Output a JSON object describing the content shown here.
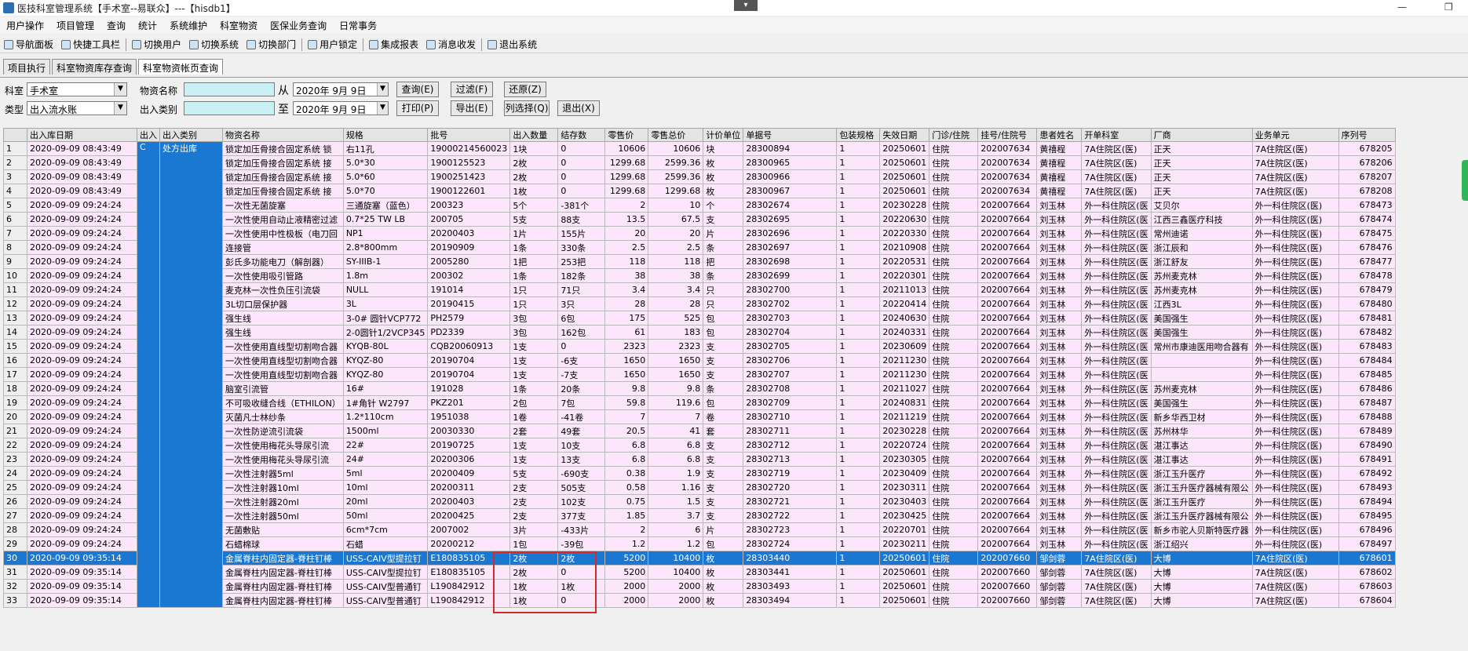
{
  "window": {
    "title": "医技科室管理系统【手术室--易联众】---【hisdb1】",
    "collapse_icon": "chevron-down-icon",
    "min_glyph": "—",
    "restore_glyph": "❐"
  },
  "menu": [
    "用户操作",
    "项目管理",
    "查询",
    "统计",
    "系统维护",
    "科室物资",
    "医保业务查询",
    "日常事务"
  ],
  "toolbar": {
    "items": [
      "导航面板",
      "快捷工具栏",
      "切换用户",
      "切换系统",
      "切换部门",
      "用户锁定",
      "集成报表",
      "消息收发",
      "退出系统"
    ]
  },
  "tabs": [
    "项目执行",
    "科室物资库存查询",
    "科室物资帐页查询"
  ],
  "active_tab": 2,
  "filters": {
    "dept_label": "科室",
    "dept_value": "手术室",
    "type_label": "类型",
    "type_value": "出入流水账",
    "item_name_label": "物资名称",
    "io_type_label": "出入类别",
    "from_label": "从",
    "to_label": "至",
    "date_from": "2020年 9月 9日",
    "date_to": "2020年 9月 9日",
    "buttons": {
      "query": "查询(E)",
      "filter": "过滤(F)",
      "restore": "还原(Z)",
      "print": "打印(P)",
      "export": "导出(E)",
      "columns": "列选择(Q)",
      "exit": "退出(X)"
    }
  },
  "grid": {
    "columns": [
      "",
      "出入库日期",
      "出入",
      "出入类别",
      "物资名称",
      "规格",
      "批号",
      "出入数量",
      "结存数",
      "零售价",
      "零售总价",
      "计价单位",
      "单据号",
      "包装规格",
      "失效日期",
      "门诊/住院",
      "挂号/住院号",
      "患者姓名",
      "开单科室",
      "厂商",
      "业务单元",
      "序列号"
    ],
    "first_row_flags": {
      "io": "C",
      "io_type": "处方出库"
    },
    "selected_row": 30,
    "rows": [
      [
        "1",
        "2020-09-09 08:43:49",
        "锁定加压骨接合固定系统 锁",
        "右11孔",
        "19000214560023",
        "1块",
        "0",
        "10606",
        "10606",
        "块",
        "28300894",
        "1",
        "20250601",
        "住院",
        "202007634",
        "黄禧程",
        "7A住院区(医)",
        "正天",
        "7A住院区(医)",
        "678205"
      ],
      [
        "2",
        "2020-09-09 08:43:49",
        "锁定加压骨接合固定系统 接",
        "5.0*30",
        "1900125523",
        "2枚",
        "0",
        "1299.68",
        "2599.36",
        "枚",
        "28300965",
        "1",
        "20250601",
        "住院",
        "202007634",
        "黄禧程",
        "7A住院区(医)",
        "正天",
        "7A住院区(医)",
        "678206"
      ],
      [
        "3",
        "2020-09-09 08:43:49",
        "锁定加压骨接合固定系统 接",
        "5.0*60",
        "1900251423",
        "2枚",
        "0",
        "1299.68",
        "2599.36",
        "枚",
        "28300966",
        "1",
        "20250601",
        "住院",
        "202007634",
        "黄禧程",
        "7A住院区(医)",
        "正天",
        "7A住院区(医)",
        "678207"
      ],
      [
        "4",
        "2020-09-09 08:43:49",
        "锁定加压骨接合固定系统 接",
        "5.0*70",
        "1900122601",
        "1枚",
        "0",
        "1299.68",
        "1299.68",
        "枚",
        "28300967",
        "1",
        "20250601",
        "住院",
        "202007634",
        "黄禧程",
        "7A住院区(医)",
        "正天",
        "7A住院区(医)",
        "678208"
      ],
      [
        "5",
        "2020-09-09 09:24:24",
        "一次性无菌旋塞",
        "三通旋塞（蓝色）",
        "200323",
        "5个",
        "-381个",
        "2",
        "10",
        "个",
        "28302674",
        "1",
        "20230228",
        "住院",
        "202007664",
        "刘玉林",
        "外一科住院区(医",
        "艾贝尔",
        "外一科住院区(医)",
        "678473"
      ],
      [
        "6",
        "2020-09-09 09:24:24",
        "一次性使用自动止液精密过滤",
        "0.7*25 TW LB",
        "200705",
        "5支",
        "88支",
        "13.5",
        "67.5",
        "支",
        "28302695",
        "1",
        "20220630",
        "住院",
        "202007664",
        "刘玉林",
        "外一科住院区(医",
        "江西三鑫医疗科技",
        "外一科住院区(医)",
        "678474"
      ],
      [
        "7",
        "2020-09-09 09:24:24",
        "一次性使用中性极板（电刀回",
        "NP1",
        "20200403",
        "1片",
        "155片",
        "20",
        "20",
        "片",
        "28302696",
        "1",
        "20220330",
        "住院",
        "202007664",
        "刘玉林",
        "外一科住院区(医",
        "常州迪诺",
        "外一科住院区(医)",
        "678475"
      ],
      [
        "8",
        "2020-09-09 09:24:24",
        "连接管",
        "2.8*800mm",
        "20190909",
        "1条",
        "330条",
        "2.5",
        "2.5",
        "条",
        "28302697",
        "1",
        "20210908",
        "住院",
        "202007664",
        "刘玉林",
        "外一科住院区(医",
        "浙江辰和",
        "外一科住院区(医)",
        "678476"
      ],
      [
        "9",
        "2020-09-09 09:24:24",
        "彭氏多功能电刀（解剖器）",
        "SY-IIIB-1",
        "2005280",
        "1把",
        "253把",
        "118",
        "118",
        "把",
        "28302698",
        "1",
        "20220531",
        "住院",
        "202007664",
        "刘玉林",
        "外一科住院区(医",
        "浙江舒友",
        "外一科住院区(医)",
        "678477"
      ],
      [
        "10",
        "2020-09-09 09:24:24",
        "一次性使用吸引管路",
        "1.8m",
        "200302",
        "1条",
        "182条",
        "38",
        "38",
        "条",
        "28302699",
        "1",
        "20220301",
        "住院",
        "202007664",
        "刘玉林",
        "外一科住院区(医",
        "苏州麦克林",
        "外一科住院区(医)",
        "678478"
      ],
      [
        "11",
        "2020-09-09 09:24:24",
        "麦克林一次性负压引流袋",
        "NULL",
        "191014",
        "1只",
        "71只",
        "3.4",
        "3.4",
        "只",
        "28302700",
        "1",
        "20211013",
        "住院",
        "202007664",
        "刘玉林",
        "外一科住院区(医",
        "苏州麦克林",
        "外一科住院区(医)",
        "678479"
      ],
      [
        "12",
        "2020-09-09 09:24:24",
        "3L切口层保护器",
        "3L",
        "20190415",
        "1只",
        "3只",
        "28",
        "28",
        "只",
        "28302702",
        "1",
        "20220414",
        "住院",
        "202007664",
        "刘玉林",
        "外一科住院区(医",
        "江西3L",
        "外一科住院区(医)",
        "678480"
      ],
      [
        "13",
        "2020-09-09 09:24:24",
        "强生线",
        "3-0# 圆针VCP772",
        "PH2579",
        "3包",
        "6包",
        "175",
        "525",
        "包",
        "28302703",
        "1",
        "20240630",
        "住院",
        "202007664",
        "刘玉林",
        "外一科住院区(医",
        "美国强生",
        "外一科住院区(医)",
        "678481"
      ],
      [
        "14",
        "2020-09-09 09:24:24",
        "强生线",
        "2-0圆针1/2VCP345",
        "PD2339",
        "3包",
        "162包",
        "61",
        "183",
        "包",
        "28302704",
        "1",
        "20240331",
        "住院",
        "202007664",
        "刘玉林",
        "外一科住院区(医",
        "美国强生",
        "外一科住院区(医)",
        "678482"
      ],
      [
        "15",
        "2020-09-09 09:24:24",
        "一次性使用直线型切割吻合器",
        "KYQB-80L",
        "CQB20060913",
        "1支",
        "0",
        "2323",
        "2323",
        "支",
        "28302705",
        "1",
        "20230609",
        "住院",
        "202007664",
        "刘玉林",
        "外一科住院区(医",
        "常州市康迪医用吻合器有",
        "外一科住院区(医)",
        "678483"
      ],
      [
        "16",
        "2020-09-09 09:24:24",
        "一次性使用直线型切割吻合器",
        "KYQZ-80",
        "20190704",
        "1支",
        "-6支",
        "1650",
        "1650",
        "支",
        "28302706",
        "1",
        "20211230",
        "住院",
        "202007664",
        "刘玉林",
        "外一科住院区(医",
        "",
        "外一科住院区(医)",
        "678484"
      ],
      [
        "17",
        "2020-09-09 09:24:24",
        "一次性使用直线型切割吻合器",
        "KYQZ-80",
        "20190704",
        "1支",
        "-7支",
        "1650",
        "1650",
        "支",
        "28302707",
        "1",
        "20211230",
        "住院",
        "202007664",
        "刘玉林",
        "外一科住院区(医",
        "",
        "外一科住院区(医)",
        "678485"
      ],
      [
        "18",
        "2020-09-09 09:24:24",
        "脑室引流管",
        "16#",
        "191028",
        "1条",
        "20条",
        "9.8",
        "9.8",
        "条",
        "28302708",
        "1",
        "20211027",
        "住院",
        "202007664",
        "刘玉林",
        "外一科住院区(医",
        "苏州麦克林",
        "外一科住院区(医)",
        "678486"
      ],
      [
        "19",
        "2020-09-09 09:24:24",
        "不可吸收缝合线（ETHILON）",
        "1#角针 W2797",
        "PKZ201",
        "2包",
        "7包",
        "59.8",
        "119.6",
        "包",
        "28302709",
        "1",
        "20240831",
        "住院",
        "202007664",
        "刘玉林",
        "外一科住院区(医",
        "美国强生",
        "外一科住院区(医)",
        "678487"
      ],
      [
        "20",
        "2020-09-09 09:24:24",
        "灭菌凡士林纱条",
        "1.2*110cm",
        "1951038",
        "1卷",
        "-41卷",
        "7",
        "7",
        "卷",
        "28302710",
        "1",
        "20211219",
        "住院",
        "202007664",
        "刘玉林",
        "外一科住院区(医",
        "新乡华西卫材",
        "外一科住院区(医)",
        "678488"
      ],
      [
        "21",
        "2020-09-09 09:24:24",
        "一次性防逆流引流袋",
        "1500ml",
        "20030330",
        "2套",
        "49套",
        "20.5",
        "41",
        "套",
        "28302711",
        "1",
        "20230228",
        "住院",
        "202007664",
        "刘玉林",
        "外一科住院区(医",
        "苏州林华",
        "外一科住院区(医)",
        "678489"
      ],
      [
        "22",
        "2020-09-09 09:24:24",
        "一次性使用梅花头导尿引流",
        "22#",
        "20190725",
        "1支",
        "10支",
        "6.8",
        "6.8",
        "支",
        "28302712",
        "1",
        "20220724",
        "住院",
        "202007664",
        "刘玉林",
        "外一科住院区(医",
        "湛江事达",
        "外一科住院区(医)",
        "678490"
      ],
      [
        "23",
        "2020-09-09 09:24:24",
        "一次性使用梅花头导尿引流",
        "24#",
        "20200306",
        "1支",
        "13支",
        "6.8",
        "6.8",
        "支",
        "28302713",
        "1",
        "20230305",
        "住院",
        "202007664",
        "刘玉林",
        "外一科住院区(医",
        "湛江事达",
        "外一科住院区(医)",
        "678491"
      ],
      [
        "24",
        "2020-09-09 09:24:24",
        "一次性注射器5ml",
        "5ml",
        "20200409",
        "5支",
        "-690支",
        "0.38",
        "1.9",
        "支",
        "28302719",
        "1",
        "20230409",
        "住院",
        "202007664",
        "刘玉林",
        "外一科住院区(医",
        "浙江玉升医疗",
        "外一科住院区(医)",
        "678492"
      ],
      [
        "25",
        "2020-09-09 09:24:24",
        "一次性注射器10ml",
        "10ml",
        "20200311",
        "2支",
        "505支",
        "0.58",
        "1.16",
        "支",
        "28302720",
        "1",
        "20230311",
        "住院",
        "202007664",
        "刘玉林",
        "外一科住院区(医",
        "浙江玉升医疗器械有限公",
        "外一科住院区(医)",
        "678493"
      ],
      [
        "26",
        "2020-09-09 09:24:24",
        "一次性注射器20ml",
        "20ml",
        "20200403",
        "2支",
        "102支",
        "0.75",
        "1.5",
        "支",
        "28302721",
        "1",
        "20230403",
        "住院",
        "202007664",
        "刘玉林",
        "外一科住院区(医",
        "浙江玉升医疗",
        "外一科住院区(医)",
        "678494"
      ],
      [
        "27",
        "2020-09-09 09:24:24",
        "一次性注射器50ml",
        "50ml",
        "20200425",
        "2支",
        "377支",
        "1.85",
        "3.7",
        "支",
        "28302722",
        "1",
        "20230425",
        "住院",
        "202007664",
        "刘玉林",
        "外一科住院区(医",
        "浙江玉升医疗器械有限公",
        "外一科住院区(医)",
        "678495"
      ],
      [
        "28",
        "2020-09-09 09:24:24",
        "无菌敷贴",
        "6cm*7cm",
        "2007002",
        "3片",
        "-433片",
        "2",
        "6",
        "片",
        "28302723",
        "1",
        "20220701",
        "住院",
        "202007664",
        "刘玉林",
        "外一科住院区(医",
        "新乡市驼人贝斯特医疗器",
        "外一科住院区(医)",
        "678496"
      ],
      [
        "29",
        "2020-09-09 09:24:24",
        "石蜡棉球",
        "石蜡",
        "20200212",
        "1包",
        "-39包",
        "1.2",
        "1.2",
        "包",
        "28302724",
        "1",
        "20230211",
        "住院",
        "202007664",
        "刘玉林",
        "外一科住院区(医",
        "浙江绍兴",
        "外一科住院区(医)",
        "678497"
      ],
      [
        "30",
        "2020-09-09 09:35:14",
        "金属脊柱内固定器-脊柱钉棒",
        "USS-CAIV型提拉钉",
        "E180835105",
        "2枚",
        "2枚",
        "5200",
        "10400",
        "枚",
        "28303440",
        "1",
        "20250601",
        "住院",
        "202007660",
        "邹剑蓉",
        "7A住院区(医)",
        "大博",
        "7A住院区(医)",
        "678601"
      ],
      [
        "31",
        "2020-09-09 09:35:14",
        "金属脊柱内固定器-脊柱钉棒",
        "USS-CAIV型提拉钉",
        "E180835105",
        "2枚",
        "0",
        "5200",
        "10400",
        "枚",
        "28303441",
        "1",
        "20250601",
        "住院",
        "202007660",
        "邹剑蓉",
        "7A住院区(医)",
        "大博",
        "7A住院区(医)",
        "678602"
      ],
      [
        "32",
        "2020-09-09 09:35:14",
        "金属脊柱内固定器-脊柱钉棒",
        "USS-CAIV型普通钉",
        "L190842912",
        "1枚",
        "1枚",
        "2000",
        "2000",
        "枚",
        "28303493",
        "1",
        "20250601",
        "住院",
        "202007660",
        "邹剑蓉",
        "7A住院区(医)",
        "大博",
        "7A住院区(医)",
        "678603"
      ],
      [
        "33",
        "2020-09-09 09:35:14",
        "金属脊柱内固定器-脊柱钉棒",
        "USS-CAIV型普通钉",
        "L190842912",
        "1枚",
        "0",
        "2000",
        "2000",
        "枚",
        "28303494",
        "1",
        "20250601",
        "住院",
        "202007660",
        "邹剑蓉",
        "7A住院区(医)",
        "大博",
        "7A住院区(医)",
        "678604"
      ]
    ]
  },
  "colors": {
    "row_bg": "#fbe6fb",
    "selected": "#1b78d2",
    "highlight_box": "#d62a2a"
  }
}
